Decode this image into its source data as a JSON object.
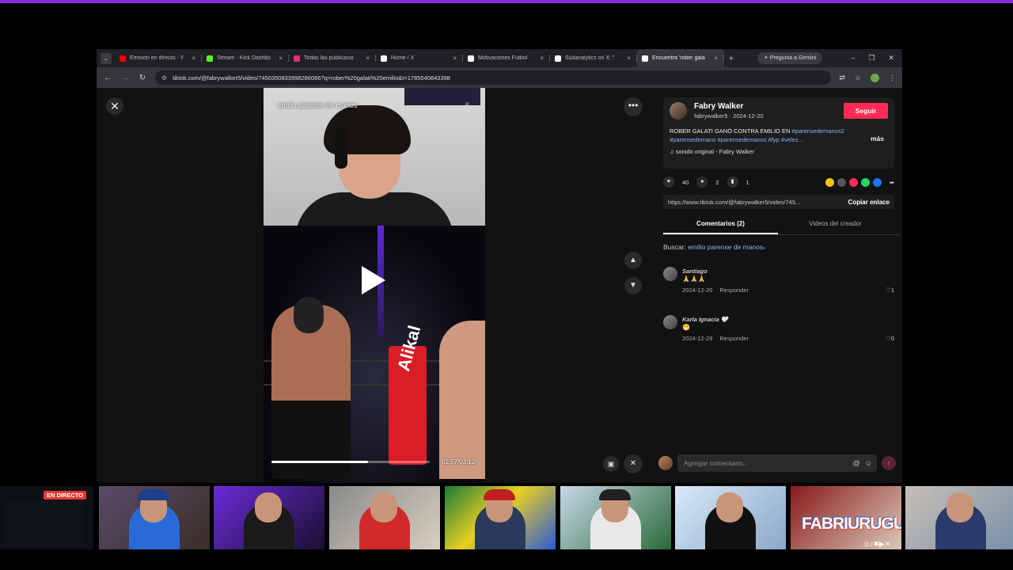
{
  "tabs": [
    {
      "title": "Emisión en directo - Y",
      "icon": "youtube-icon",
      "color": "#ff0000"
    },
    {
      "title": "Stream - Kick Dashbo",
      "icon": "kick-icon",
      "color": "#53fc18"
    },
    {
      "title": "Todas las publicacio",
      "icon": "instagram-icon",
      "color": "#e1306c"
    },
    {
      "title": "Home / X",
      "icon": "x-icon",
      "color": "#ffffff"
    },
    {
      "title": "Motivaciones Fútbol",
      "icon": "x-icon",
      "color": "#ffffff"
    },
    {
      "title": "Sudanalytics on X: \"",
      "icon": "x-icon",
      "color": "#ffffff"
    },
    {
      "title": "Encuentra 'rober gala",
      "icon": "tiktok-icon",
      "color": "#ffffff"
    }
  ],
  "active_tab_index": 6,
  "gemini_label": "Pregunta a Gemini",
  "url": "tiktok.com/@fabrywalker5/video/7450350833998286086?q=rober%20galati%20emilio&t=1785540843398",
  "video": {
    "search_overlay": "emilio parense de manos",
    "post_text": "Alikal",
    "timecode": "01:57/03:12",
    "progress": 0.61
  },
  "creator": {
    "name": "Fabry Walker",
    "sub": "fabrywalker5 · 2024-12-20",
    "follow_label": "Seguir",
    "desc_plain": "ROBER GALATI GANÓ CONTRA EMILIO EN ",
    "desc_tags": "#parensedemanos2 #parensedemano #parensedemanos #fyp #velez...",
    "more_label": "más",
    "sound": "sonido original - Fabry Walker"
  },
  "stats": {
    "likes": "40",
    "comments": "2",
    "saves": "1"
  },
  "share_colors": [
    "#f4c20d",
    "#555555",
    "#fe2c55",
    "#25d366",
    "#1877f2"
  ],
  "copy": {
    "url": "https://www.tiktok.com/@fabrywalker5/video/745...",
    "button": "Copiar enlace"
  },
  "panel_tabs": {
    "comments": "Comentarios (2)",
    "creator_videos": "Videos del creador"
  },
  "search_label": "Buscar: ",
  "search_query": "emilio parense de manos",
  "comments": [
    {
      "user": "Santiago",
      "text": "🙏🙏🙏",
      "date": "2024-12-20",
      "reply": "Responder",
      "likes": "1"
    },
    {
      "user": "Karla Ignacia 🤍",
      "text": "😁",
      "date": "2024-12-29",
      "reply": "Responder",
      "likes": "0"
    }
  ],
  "comment_placeholder": "Agregar comentario...",
  "stream": {
    "live_label": "EN DIRECTO",
    "brand": "FABRIURUGUAYO",
    "brand_icons": "◎♪✖▶✕"
  }
}
